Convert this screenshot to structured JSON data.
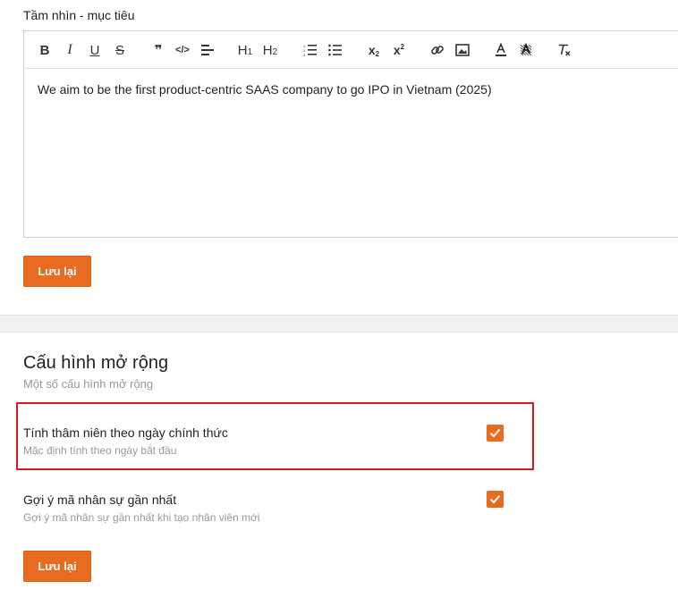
{
  "vision": {
    "label": "Tầm nhìn - mục tiêu",
    "content": "We aim to be the first product-centric SAAS company to go IPO in Vietnam (2025)",
    "save_label": "Lưu lại"
  },
  "toolbar": {
    "bold": "B",
    "italic": "I",
    "underline": "U",
    "strike": "S",
    "quote": "❞",
    "code": "</>",
    "h1": "H",
    "h1_sub": "1",
    "h2": "H",
    "h2_sub": "2",
    "subscript": "x",
    "subscript_mark": "2",
    "superscript": "x",
    "superscript_mark": "2"
  },
  "extended": {
    "title": "Cấu hình mở rộng",
    "subtitle": "Một số cấu hình mở rộng",
    "options": [
      {
        "title": "Tính thâm niên theo ngày chính thức",
        "desc": "Mặc định tính theo ngày bắt đầu",
        "checked": true
      },
      {
        "title": "Gợi ý mã nhân sự gần nhất",
        "desc": "Gợi ý mã nhân sự gần nhất khi tạo nhân viên mới",
        "checked": true
      }
    ],
    "save_label": "Lưu lại"
  },
  "colors": {
    "accent": "#e86b1f",
    "highlight": "#e3141c"
  }
}
